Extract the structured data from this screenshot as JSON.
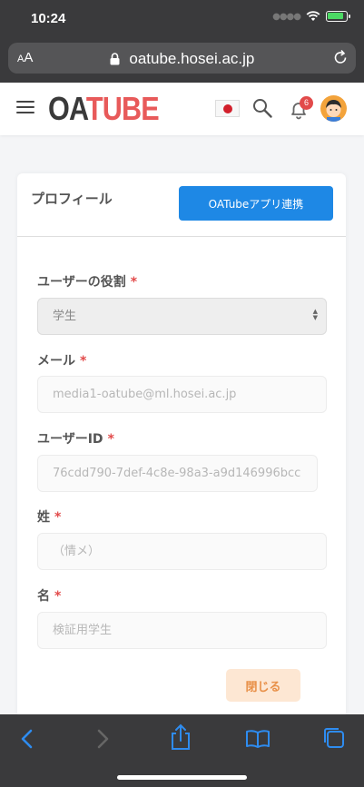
{
  "status": {
    "time": "10:24"
  },
  "browser": {
    "aa_small": "A",
    "aa_large": "A",
    "url": "oatube.hosei.ac.jp"
  },
  "header": {
    "logo_oa": "OA",
    "logo_tube": "TUBE",
    "notification_count": "6"
  },
  "card": {
    "title": "プロフィール",
    "app_link_button": "OATubeアプリ連携"
  },
  "form": {
    "role": {
      "label": "ユーザーの役割",
      "required": "*",
      "value": "学生"
    },
    "email": {
      "label": "メール",
      "required": "*",
      "value": "media1-oatube@ml.hosei.ac.jp"
    },
    "user_id": {
      "label": "ユーザーID",
      "required": "*",
      "value": "76cdd790-7def-4c8e-98a3-a9d146996bcc"
    },
    "last_name": {
      "label": "姓",
      "required": "*",
      "value": "（情メ）"
    },
    "first_name": {
      "label": "名",
      "required": "*",
      "value": "検証用学生"
    },
    "close_button": "閉じる"
  },
  "colors": {
    "primary_blue": "#1e88e5",
    "required_red": "#e24a4a",
    "close_peach": "#fde7d3",
    "logo_red": "#e85a5a"
  }
}
